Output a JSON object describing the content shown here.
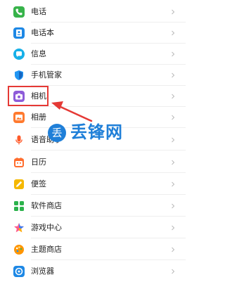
{
  "settings": {
    "items": [
      {
        "label": "电话",
        "icon": "phone-icon",
        "color": "#37b34a"
      },
      {
        "label": "电话本",
        "icon": "contacts-icon",
        "color": "#1e88e5"
      },
      {
        "label": "信息",
        "icon": "message-icon",
        "color": "#17b0e8"
      },
      {
        "label": "手机管家",
        "icon": "shield-icon",
        "color": "#2196f3"
      },
      {
        "label": "相机",
        "icon": "camera-icon",
        "color": "#8e5cd9"
      },
      {
        "label": "相册",
        "icon": "gallery-icon",
        "color": "#ff7a2f"
      },
      {
        "label": "语音助手",
        "icon": "voice-assistant-icon",
        "color": "#ff5a2a"
      },
      {
        "label": "日历",
        "icon": "calendar-icon",
        "color": "#ff6d2e"
      },
      {
        "label": "便签",
        "icon": "notes-icon",
        "color": "#f5b800"
      },
      {
        "label": "软件商店",
        "icon": "app-store-icon",
        "color": "#2bb24c"
      },
      {
        "label": "游戏中心",
        "icon": "game-center-icon",
        "color": "#ff5b8a"
      },
      {
        "label": "主题商店",
        "icon": "theme-store-icon",
        "color": "#ff9500"
      },
      {
        "label": "浏览器",
        "icon": "browser-icon",
        "color": "#1e88e5"
      }
    ]
  },
  "annotation": {
    "highlight_color": "#e53935"
  },
  "watermark": {
    "logo_char": "丢",
    "text": "丢锋网",
    "color": "#1f7fd8"
  }
}
